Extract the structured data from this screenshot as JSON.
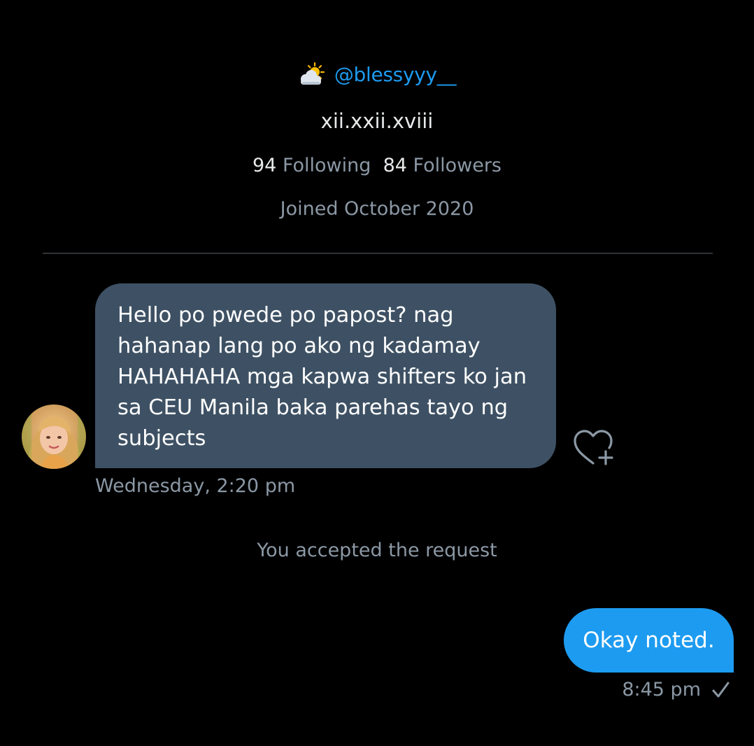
{
  "profile": {
    "handle_icon": "sun-behind-cloud-icon",
    "handle": "@blessyyy__",
    "bio": "xii.xxii.xviii",
    "following_count": "94",
    "following_label": "Following",
    "followers_count": "84",
    "followers_label": "Followers",
    "joined": "Joined October 2020"
  },
  "messages": [
    {
      "direction": "incoming",
      "text": "Hello po pwede po papost? nag hahanap lang po ako ng kadamay HAHAHAHA mga kapwa shifters ko jan sa CEU Manila baka parehas tayo ng subjects",
      "timestamp": "Wednesday, 2:20 pm"
    },
    {
      "direction": "outgoing",
      "text": "Okay noted.",
      "timestamp": "8:45 pm",
      "status_icon": "sent-check-icon"
    }
  ],
  "system_note": "You accepted the request",
  "colors": {
    "background": "#000000",
    "accent": "#1d9bf0",
    "incoming_bubble": "#3e5164",
    "secondary_text": "#8b98a5",
    "divider": "#2f3336"
  }
}
